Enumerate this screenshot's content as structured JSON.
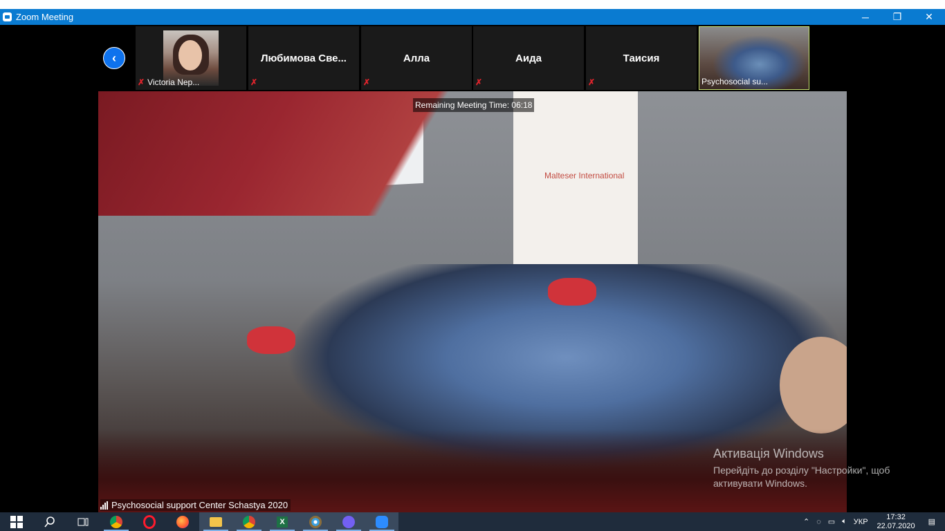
{
  "window": {
    "title": "Zoom Meeting",
    "minimize_glyph": "─",
    "restore_glyph": "❐",
    "close_glyph": "✕"
  },
  "gallery": {
    "prev_glyph": "‹",
    "tiles": [
      {
        "name": "Victoria Nep...",
        "has_video": true,
        "muted": true
      },
      {
        "name": "Любимова  Све...",
        "has_video": false,
        "muted": true
      },
      {
        "name": "Алла",
        "has_video": false,
        "muted": true
      },
      {
        "name": "Аида",
        "has_video": false,
        "muted": true
      },
      {
        "name": "Таисия",
        "has_video": false,
        "muted": true
      },
      {
        "name": "Psychosocial su...",
        "has_video": true,
        "muted": false,
        "active_speaker": true
      }
    ],
    "mute_glyph": "✗"
  },
  "main_video": {
    "remaining_time": "Remaining Meeting Time: 06:18",
    "speaker_label": "Psychosocial support Center Schastya 2020",
    "banner_text": "Malteser International"
  },
  "activation": {
    "title": "Активація Windows",
    "line1": "Перейдіть до розділу \"Настройки\", щоб",
    "line2": "активувати Windows."
  },
  "taskbar": {
    "apps": [
      "start-icon",
      "search-icon",
      "task-view-icon",
      "chrome-icon",
      "opera-icon",
      "firefox-icon",
      "file-explorer-icon",
      "chrome-icon",
      "excel-icon",
      "paint-icon",
      "viber-icon",
      "zoom-icon"
    ],
    "tray": {
      "language": "УКР",
      "time": "17:32",
      "date": "22.07.2020"
    }
  },
  "colors": {
    "titlebar": "#0a7bd1",
    "zoom_blue": "#0e72ed",
    "active_speaker_border": "#c9e66f",
    "mute_red": "#e0242c",
    "taskbar": "#1f2c3c"
  }
}
